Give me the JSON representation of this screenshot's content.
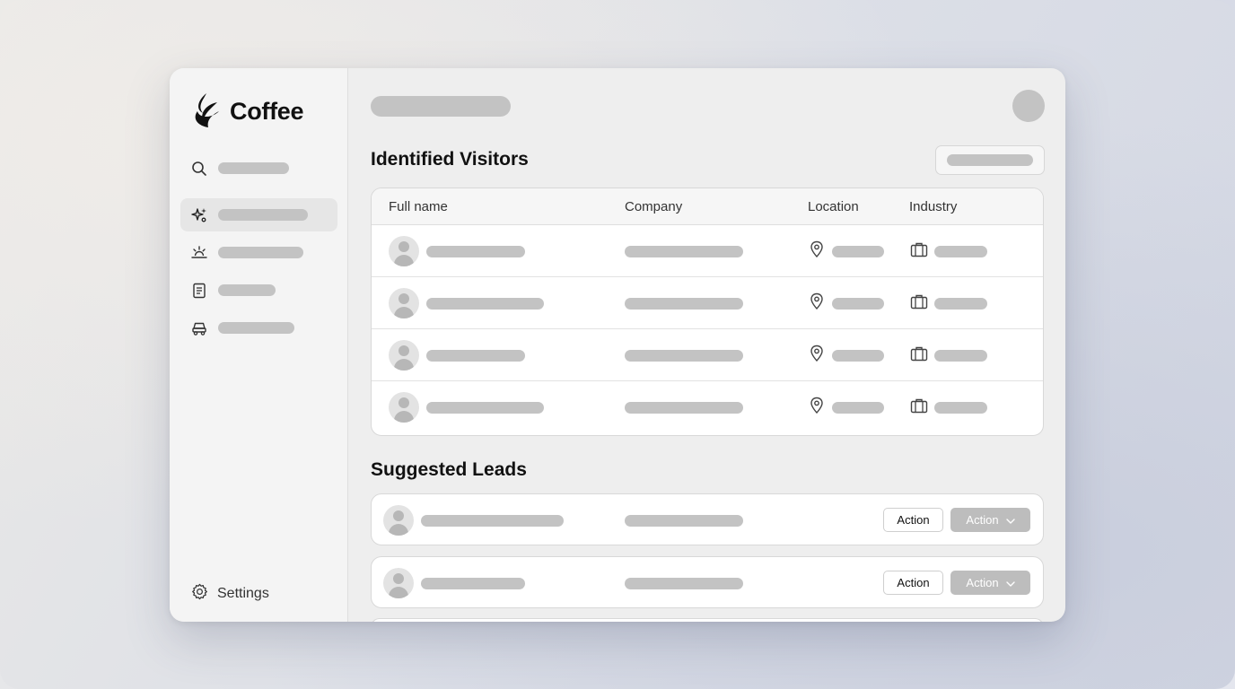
{
  "app": {
    "brand_name": "Coffee"
  },
  "sidebar": {
    "search_icon": "search-icon",
    "items": [
      {
        "icon": "sparkle-icon",
        "active": true
      },
      {
        "icon": "sunrise-icon",
        "active": false
      },
      {
        "icon": "document-icon",
        "active": false
      },
      {
        "icon": "car-icon",
        "active": false
      }
    ],
    "settings_label": "Settings"
  },
  "visitors": {
    "title": "Identified Visitors",
    "columns": [
      "Full name",
      "Company",
      "Location",
      "Industry"
    ],
    "row_count": 4
  },
  "leads": {
    "title": "Suggested Leads",
    "items": [
      {
        "primary_action": "Action",
        "secondary_action": "Action"
      },
      {
        "primary_action": "Action",
        "secondary_action": "Action"
      }
    ]
  },
  "colors": {
    "placeholder": "#c3c3c3",
    "text": "#111111",
    "surface": "#ffffff"
  }
}
